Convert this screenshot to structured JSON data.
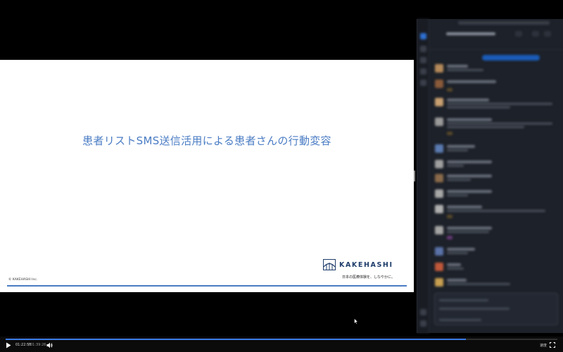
{
  "slide": {
    "title": "患者リストSMS送信活用による患者さんの行動変容",
    "logo_text": "KAKEHASHI",
    "tagline": "日本の医療体験を、しなやかに。",
    "copyright": "© KAKEHASHI Inc."
  },
  "player": {
    "current_time": "01:22:58",
    "separator": "/",
    "total_time": "01:39:26",
    "speed_label": "速度",
    "progress_fraction": 0.834,
    "accent_color": "#3b7be8"
  },
  "colors": {
    "slide_accent": "#4a7cc4",
    "logo_navy": "#1f3d6b",
    "chat_bg": "#1d2129"
  },
  "icons": {
    "play": "play-icon",
    "volume": "volume-icon",
    "fullscreen": "fullscreen-icon",
    "logo": "kakehashi-logo-icon",
    "cursor": "mouse-cursor-icon"
  }
}
